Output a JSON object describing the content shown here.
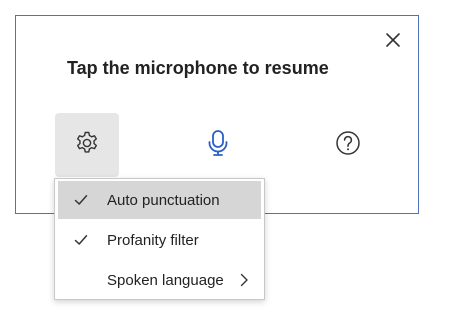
{
  "dialog": {
    "title": "Tap the microphone to resume",
    "close_icon": "close-icon",
    "border_color": "#4f72b8"
  },
  "toolbar": {
    "settings_icon": "gear-icon",
    "microphone_icon": "microphone-icon",
    "help_icon": "help-icon",
    "accent_color": "#2b5fc7"
  },
  "menu": {
    "items": [
      {
        "label": "Auto punctuation",
        "checked": true,
        "highlighted": true,
        "has_submenu": false
      },
      {
        "label": "Profanity filter",
        "checked": true,
        "highlighted": false,
        "has_submenu": false
      },
      {
        "label": "Spoken language",
        "checked": false,
        "highlighted": false,
        "has_submenu": true
      }
    ]
  }
}
